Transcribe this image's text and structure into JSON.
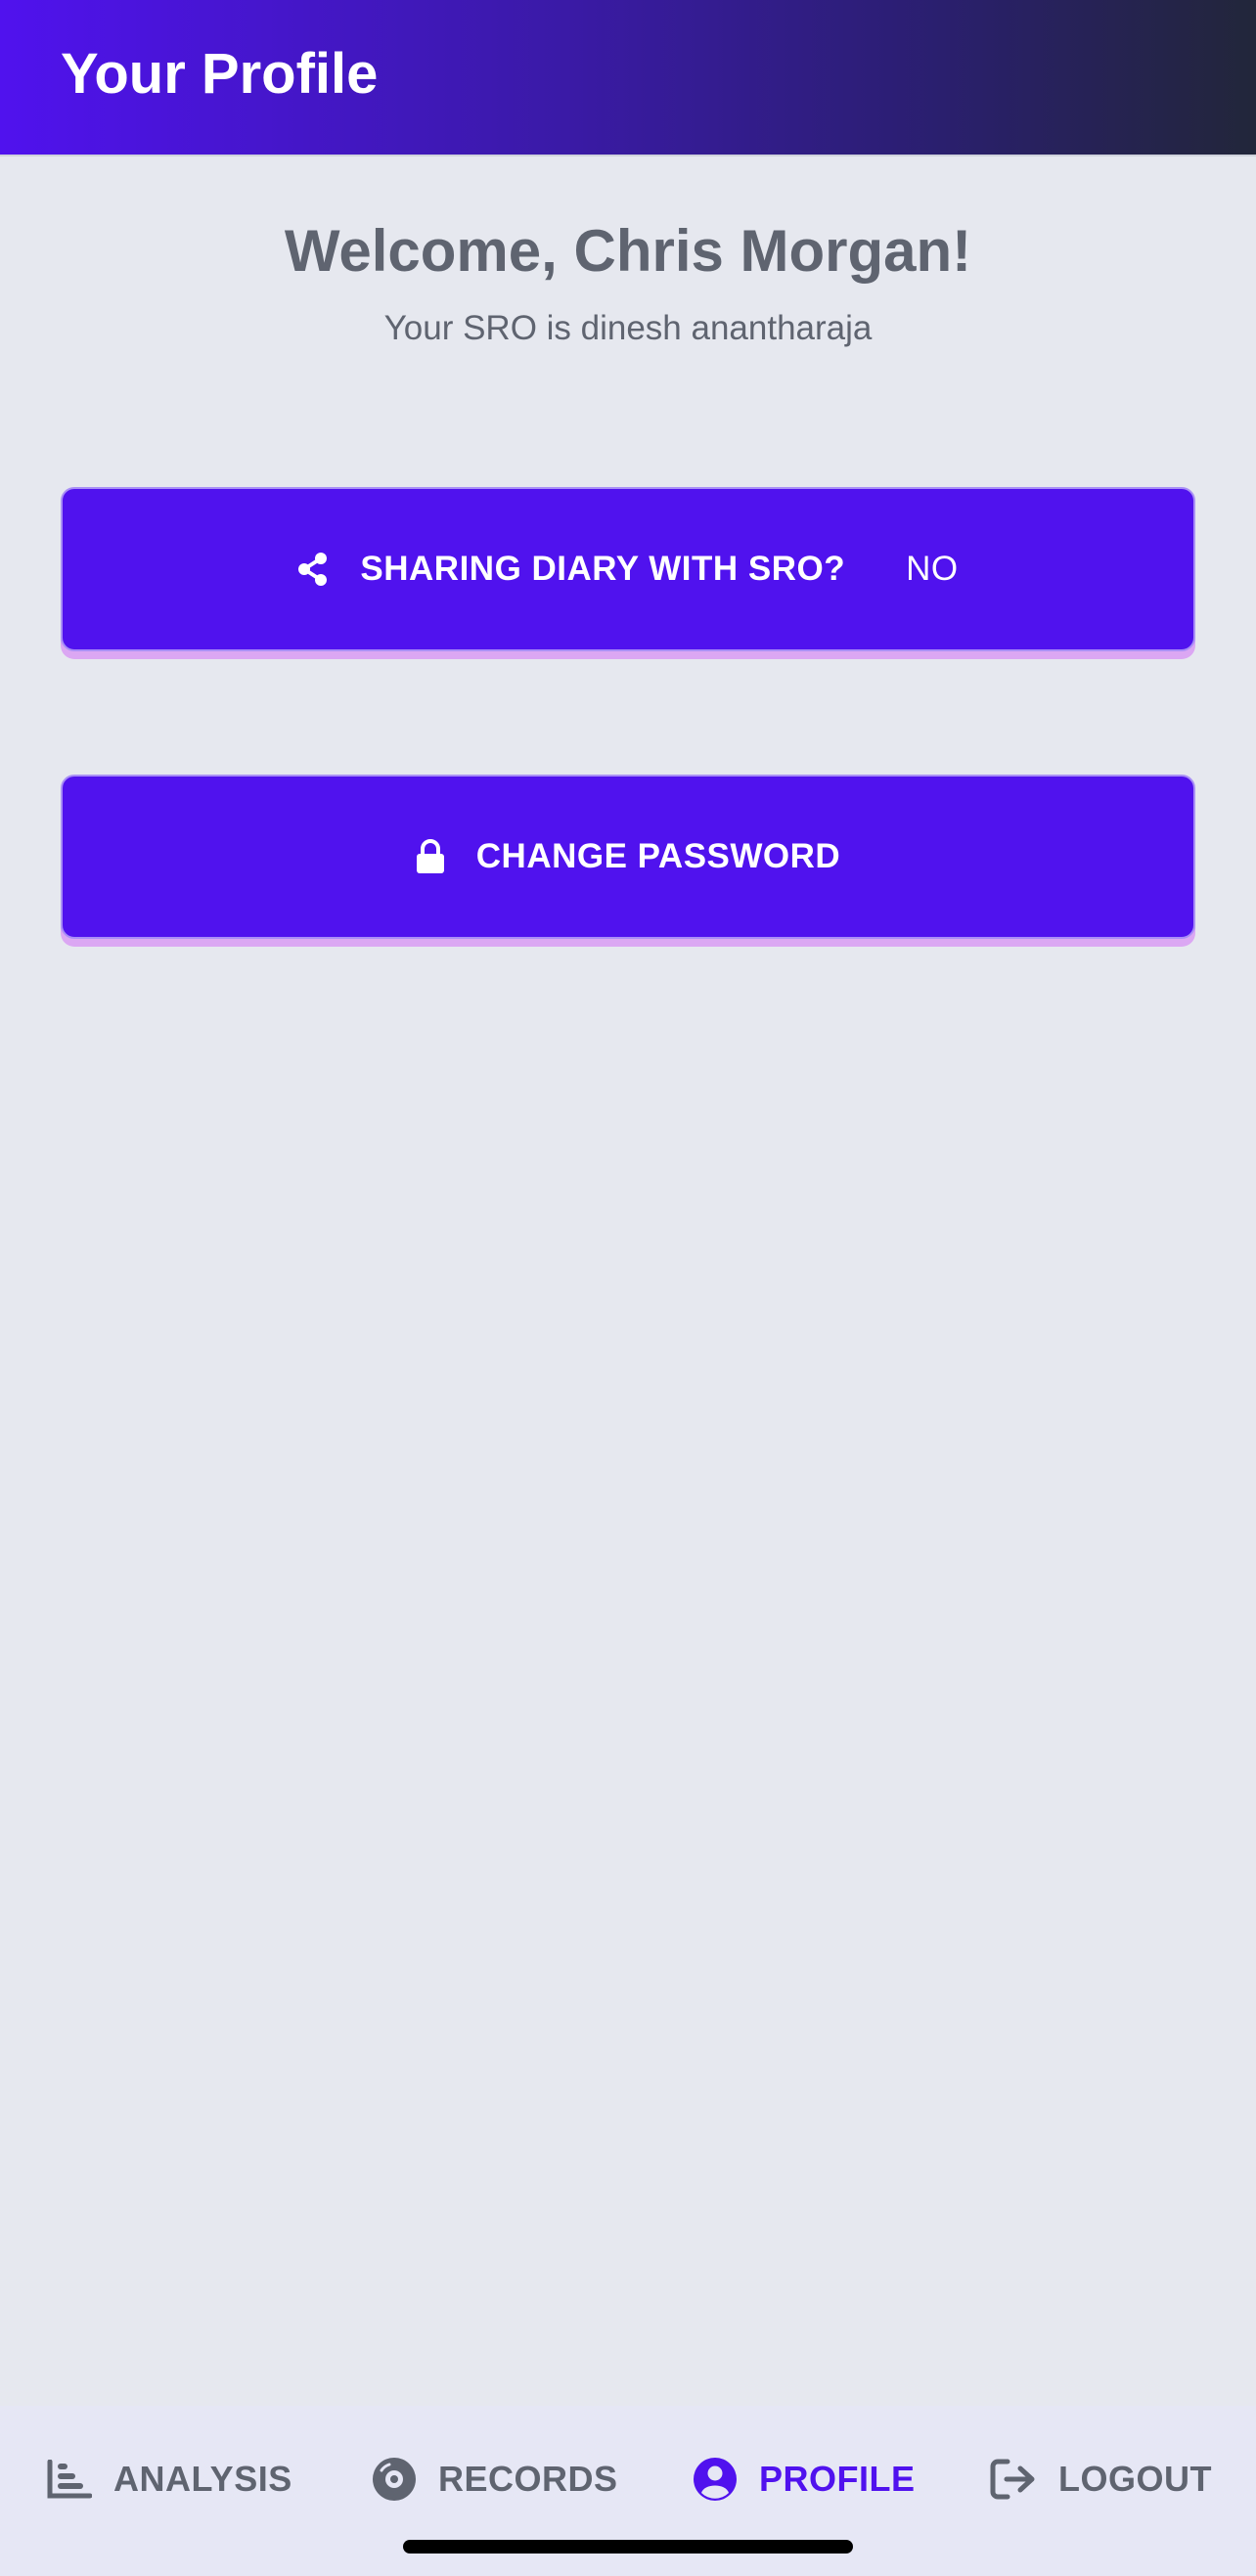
{
  "header": {
    "title": "Your Profile"
  },
  "profile": {
    "welcome": "Welcome, Chris Morgan!",
    "sro_text": "Your SRO is dinesh anantharaja"
  },
  "buttons": {
    "sharing": {
      "label": "SHARING DIARY WITH SRO?",
      "value": "NO",
      "icon": "share-icon"
    },
    "password": {
      "label": "CHANGE PASSWORD",
      "icon": "lock-icon"
    }
  },
  "nav": {
    "items": [
      {
        "label": "ANALYSIS",
        "icon": "bar-chart-icon",
        "active": false
      },
      {
        "label": "RECORDS",
        "icon": "record-disc-icon",
        "active": false
      },
      {
        "label": "PROFILE",
        "icon": "user-circle-icon",
        "active": true
      },
      {
        "label": "LOGOUT",
        "icon": "logout-icon",
        "active": false
      }
    ]
  },
  "colors": {
    "accent": "#5012ee",
    "header_gradient_end": "#22263a",
    "background": "#e6e8ef",
    "text_muted": "#5f6470"
  }
}
